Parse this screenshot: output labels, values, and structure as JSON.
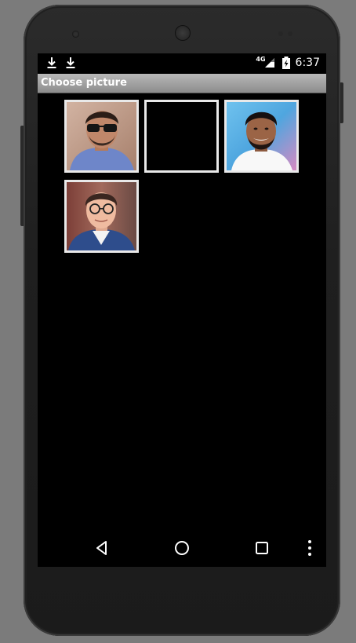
{
  "status_bar": {
    "network_label": "4G",
    "time": "6:37",
    "notification_icons": [
      "download-icon",
      "download-icon"
    ]
  },
  "action_bar": {
    "title": "Choose picture"
  },
  "gallery": {
    "items": [
      {
        "kind": "photo",
        "subject": "man-sunglasses",
        "bg": "#c8a796",
        "shirt": "#6e86c9"
      },
      {
        "kind": "empty"
      },
      {
        "kind": "photo",
        "subject": "man-beard-white-shirt",
        "bg": "#57b2e6",
        "shirt": "#ffffff"
      },
      {
        "kind": "photo",
        "subject": "man-glasses-blazer",
        "bg": "#8a5148",
        "shirt": "#2e4d8c"
      }
    ]
  },
  "nav_bar": {
    "icons": [
      "back-icon",
      "home-icon",
      "recents-icon",
      "overflow-menu-icon"
    ]
  },
  "colors": {
    "screen_bg": "#000000",
    "action_bar_top": "#b8b8b8",
    "action_bar_bottom": "#8c8c8c",
    "tile_border": "#e9e9e9",
    "device_body": "#1f1f1f",
    "backdrop": "#7b7b7b"
  }
}
